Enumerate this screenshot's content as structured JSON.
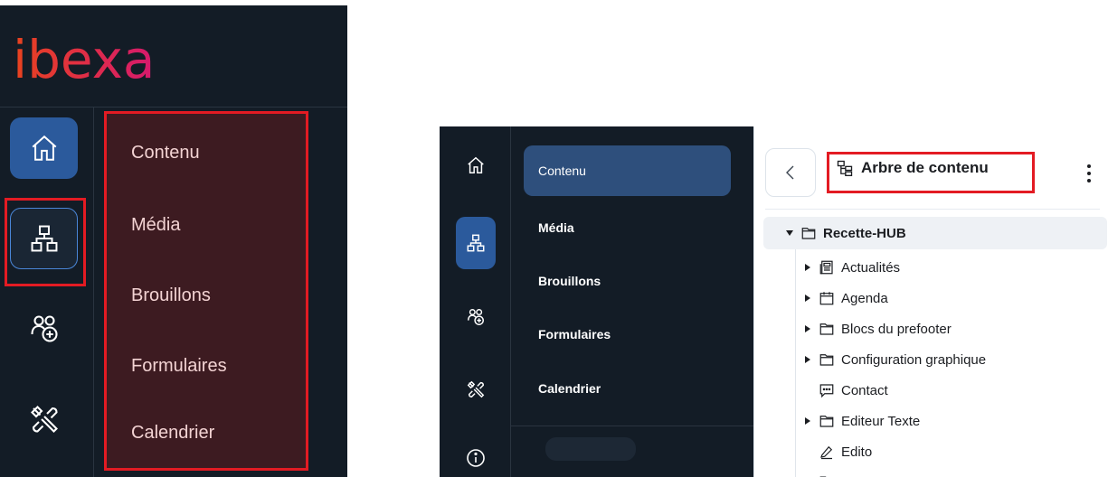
{
  "logo": {
    "text": "ibexa"
  },
  "left_rail": {
    "icons": [
      "home-icon",
      "content-tree-icon",
      "users-icon",
      "tools-icon"
    ]
  },
  "left_menu": {
    "items": [
      {
        "label": "Contenu"
      },
      {
        "label": "Média"
      },
      {
        "label": "Brouillons"
      },
      {
        "label": "Formulaires"
      },
      {
        "label": "Calendrier"
      }
    ]
  },
  "right_menu": {
    "items": [
      {
        "label": "Contenu",
        "active": true
      },
      {
        "label": "Média"
      },
      {
        "label": "Brouillons"
      },
      {
        "label": "Formulaires"
      },
      {
        "label": "Calendrier"
      }
    ]
  },
  "tree": {
    "title": "Arbre de contenu",
    "root": {
      "label": "Recette-HUB",
      "icon": "folder-icon"
    },
    "children": [
      {
        "label": "Actualités",
        "icon": "news-icon",
        "expandable": true
      },
      {
        "label": "Agenda",
        "icon": "calendar-icon",
        "expandable": true
      },
      {
        "label": "Blocs du prefooter",
        "icon": "folder-icon",
        "expandable": true
      },
      {
        "label": "Configuration graphique",
        "icon": "folder-icon",
        "expandable": true
      },
      {
        "label": "Contact",
        "icon": "message-icon",
        "expandable": false
      },
      {
        "label": "Editeur Texte",
        "icon": "folder-icon",
        "expandable": true
      },
      {
        "label": "Edito",
        "icon": "pen-icon",
        "expandable": false
      }
    ]
  },
  "colors": {
    "sidebar_bg": "#131c26",
    "accent": "#2b5a9c",
    "highlight": "#e31b23",
    "logo_start": "#e8431e",
    "logo_end": "#d6196e"
  }
}
